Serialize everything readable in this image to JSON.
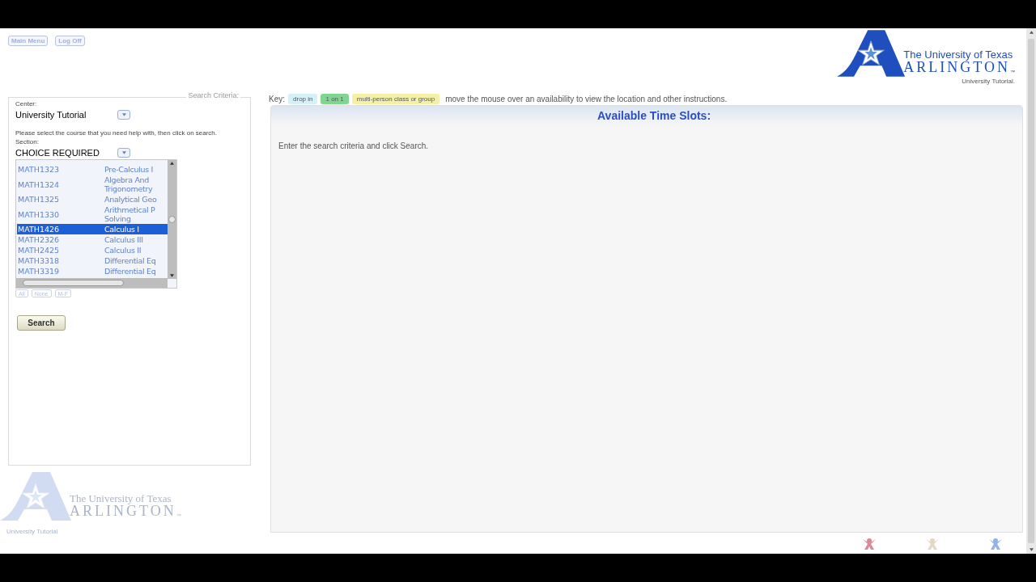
{
  "top_buttons": [
    {
      "label": "Main Menu"
    },
    {
      "label": "Log Off"
    }
  ],
  "logo": {
    "line1": "The University of Texas",
    "line2": "ARLINGTON",
    "tm": "™",
    "subtitle": "University Tutorial."
  },
  "search_criteria": {
    "legend": "Search Criteria:",
    "center_label": "Center:",
    "center_value": "University Tutorial",
    "instructions": "Please select the course that you need help with, then click on search.",
    "section_label": "Section:",
    "section_value": "CHOICE REQUIRED",
    "courses": [
      {
        "code": "MATH1323",
        "title": "Pre-Calculus I",
        "selected": false
      },
      {
        "code": "MATH1324",
        "title": "Algebra And\nTrigonometry",
        "selected": false
      },
      {
        "code": "MATH1325",
        "title": "Analytical Geo",
        "selected": false
      },
      {
        "code": "MATH1330",
        "title": "Arithmetical P\nSolving",
        "selected": false
      },
      {
        "code": "MATH1426",
        "title": "Calculus I",
        "selected": true
      },
      {
        "code": "MATH2326",
        "title": "Calculus III",
        "selected": false
      },
      {
        "code": "MATH2425",
        "title": "Calculus II",
        "selected": false
      },
      {
        "code": "MATH3318",
        "title": "Differential Eq",
        "selected": false
      },
      {
        "code": "MATH3319",
        "title": "Differential Eq",
        "selected": false
      }
    ],
    "day_buttons": [
      "All",
      "None",
      "M-F"
    ],
    "search_button": "Search"
  },
  "key": {
    "label": "Key:",
    "items": [
      {
        "label": "drop in",
        "color": "#d3f1f6"
      },
      {
        "label": "1 on 1",
        "color": "#80d68f"
      },
      {
        "label": "multi-person class or group",
        "color": "#f4f1a6"
      }
    ],
    "hint": "move the mouse over an availability to view the location and other instructions."
  },
  "results": {
    "title": "Available Time Slots:",
    "message": "Enter the search criteria and click Search."
  },
  "footer_logo": {
    "line1": "The University of Texas",
    "line2": "ARLINGTON",
    "tm": "™",
    "subtitle": "University Tutorial"
  }
}
